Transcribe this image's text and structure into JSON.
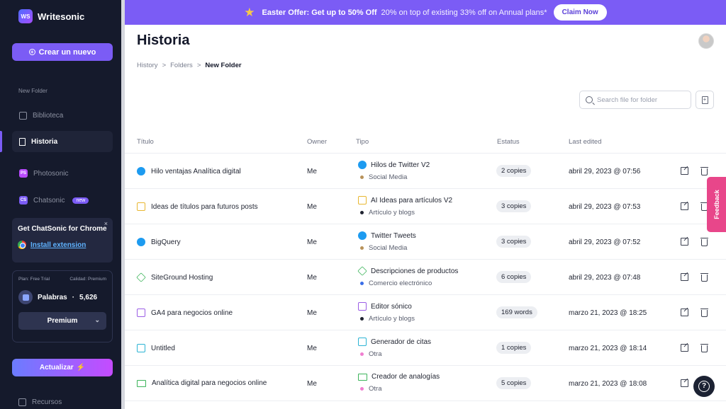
{
  "app": {
    "logo_mark": "WS",
    "name": "Writesonic"
  },
  "sidebar": {
    "create_label": "Crear un nuevo",
    "folder_label": "New Folder",
    "items": [
      {
        "label": "Biblioteca",
        "icon": "library-icon"
      },
      {
        "label": "Historia",
        "icon": "bookmark-icon",
        "active": true
      }
    ],
    "apps": [
      {
        "label": "Photosonic",
        "badge": "PS",
        "color": "#b94bff"
      },
      {
        "label": "Chatsonic",
        "badge": "CS",
        "color": "#7b5cf5",
        "tag": "new"
      }
    ],
    "chrome_card": {
      "title": "Get ChatSonic for Chrome",
      "close": "×",
      "link": "Install extension"
    },
    "plan": {
      "plan_text": "Plan: Free Trial",
      "quality_text": "Calidad: Premium",
      "words_label": "Palabras",
      "words_sep": "·",
      "words_value": "5,626",
      "quality_select": "Premium"
    },
    "upgrade_label": "Actualizar",
    "resources_label": "Recursos"
  },
  "banner": {
    "bold": "Easter Offer: Get up to 50% Off",
    "rest": "20% on top of existing 33% off on Annual plans*",
    "cta": "Claim Now"
  },
  "page": {
    "title": "Historia",
    "breadcrumb": [
      "History",
      "Folders",
      "New Folder"
    ],
    "breadcrumb_sep": ">",
    "search_placeholder": "Search file for folder"
  },
  "table": {
    "headers": {
      "title": "Título",
      "owner": "Owner",
      "tipo": "Tipo",
      "status": "Estatus",
      "edited": "Last edited"
    },
    "rows": [
      {
        "title": "Hilo ventajas Analítica digital",
        "icon": "twitter-icon",
        "owner": "Me",
        "tipo": "Hilos de Twitter V2",
        "category": "Social Media",
        "dot": "#b8925a",
        "status": "2 copies",
        "date": "abril 29, 2023 @ 07:56"
      },
      {
        "title": "Ideas de títulos para futuros posts",
        "icon": "ideas-icon",
        "owner": "Me",
        "tipo": "AI Ideas para artículos V2",
        "category": "Artículo y blogs",
        "dot": "#1f2330",
        "status": "3 copies",
        "date": "abril 29, 2023 @ 07:53"
      },
      {
        "title": "BigQuery",
        "icon": "twitter-icon",
        "owner": "Me",
        "tipo": "Twitter Tweets",
        "category": "Social Media",
        "dot": "#b8925a",
        "status": "3 copies",
        "date": "abril 29, 2023 @ 07:52"
      },
      {
        "title": "SiteGround Hosting",
        "icon": "product-cube-icon",
        "owner": "Me",
        "tipo": "Descripciones de productos",
        "category": "Comercio electrónico",
        "dot": "#3a6ee8",
        "status": "6 copies",
        "date": "abril 29, 2023 @ 07:48"
      },
      {
        "title": "GA4 para negocios online",
        "icon": "editor-pen-icon",
        "owner": "Me",
        "tipo": "Editor sónico",
        "category": "Artículo y blogs",
        "dot": "#1f2330",
        "status": "169 words",
        "date": "marzo 21, 2023 @ 18:25"
      },
      {
        "title": "Untitled",
        "icon": "quote-icon",
        "owner": "Me",
        "tipo": "Generador de citas",
        "category": "Otra",
        "dot": "#f07fd0",
        "status": "1 copies",
        "date": "marzo 21, 2023 @ 18:14"
      },
      {
        "title": "Analítica digital para negocios online",
        "icon": "analogy-icon",
        "owner": "Me",
        "tipo": "Creador de analogías",
        "category": "Otra",
        "dot": "#f07fd0",
        "status": "5 copies",
        "date": "marzo 21, 2023 @ 18:08"
      }
    ]
  },
  "feedback_label": "Feedback",
  "help_label": "?"
}
